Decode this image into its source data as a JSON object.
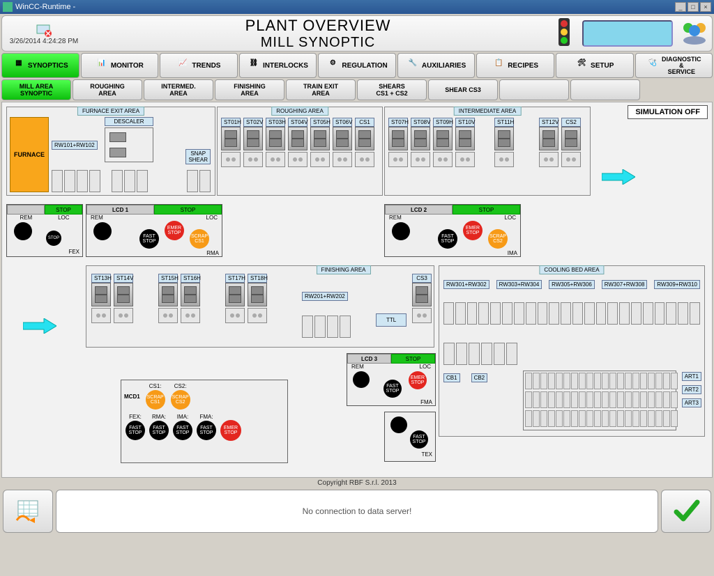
{
  "window": {
    "title": "WinCC-Runtime -"
  },
  "header": {
    "timestamp": "3/26/2014 4:24:28 PM",
    "title1": "PLANT OVERVIEW",
    "title2": "MILL SYNOPTIC"
  },
  "nav": [
    "SYNOPTICS",
    "MONITOR",
    "TRENDS",
    "INTERLOCKS",
    "REGULATION",
    "AUXILIARIES",
    "RECIPES",
    "SETUP",
    "DIAGNOSTIC\n&\nSERVICE"
  ],
  "nav_active": 0,
  "subnav": [
    "MILL AREA\nSYNOPTIC",
    "ROUGHING\nAREA",
    "INTERMED.\nAREA",
    "FINISHING\nAREA",
    "TRAIN EXIT\nAREA",
    "SHEARS\nCS1 + CS2",
    "SHEAR CS3",
    "",
    ""
  ],
  "subnav_active": 0,
  "simulation": "SIMULATION OFF",
  "areas": {
    "furnace_exit": "FURNACE EXIT AREA",
    "roughing": "ROUGHING AREA",
    "intermediate": "INTERMEDIATE AREA",
    "finishing": "FINISHING AREA",
    "cooling": "COOLING BED AREA",
    "furnace": "FURNACE",
    "descaler": "DESCALER",
    "snap_shear": "SNAP\nSHEAR",
    "rw101": "RW101+RW102",
    "rw201": "RW201+RW202",
    "ttl": "TTL"
  },
  "stands": {
    "row1a": [
      "ST01H",
      "ST02V",
      "ST03H",
      "ST04V",
      "ST05H",
      "ST06V",
      "CS1"
    ],
    "row1b": [
      "ST07H",
      "ST08V",
      "ST09H",
      "ST10V"
    ],
    "row1c": [
      "ST11H"
    ],
    "row1d": [
      "ST12V",
      "CS2"
    ],
    "row2a": [
      "ST13H",
      "ST14V"
    ],
    "row2b": [
      "ST15H",
      "ST16H"
    ],
    "row2c": [
      "ST17H",
      "ST18H"
    ],
    "cs3": "CS3",
    "cooling_rw": [
      "RW301+RW302",
      "RW303+RW304",
      "RW305+RW306",
      "RW307+RW308",
      "RW309+RW310"
    ],
    "cb": [
      "CB1",
      "CB2"
    ],
    "art": [
      "ART1",
      "ART2",
      "ART3"
    ]
  },
  "lcd": {
    "fex": {
      "stop": "STOP",
      "rem": "REM",
      "loc": "LOC",
      "tag": "FEX"
    },
    "lcd1": {
      "title": "LCD 1",
      "stop": "STOP",
      "rem": "REM",
      "loc": "LOC",
      "emer": "EMER\nSTOP",
      "fast": "FAST\nSTOP",
      "scrap": "SCRAP\nCS1",
      "tag": "RMA"
    },
    "lcd2": {
      "title": "LCD 2",
      "stop": "STOP",
      "rem": "REM",
      "loc": "LOC",
      "emer": "EMER\nSTOP",
      "fast": "FAST\nSTOP",
      "scrap": "SCRAP\nCS2",
      "tag": "IMA"
    },
    "lcd3": {
      "title": "LCD 3",
      "stop": "STOP",
      "rem": "REM",
      "loc": "LOC",
      "emer": "EMER\nSTOP",
      "fast": "FAST\nSTOP",
      "tag": "FMA"
    },
    "tex": {
      "fast": "FAST\nSTOP",
      "tag": "TEX"
    }
  },
  "mcd": {
    "title": "MCD1",
    "cs1": "CS1:",
    "cs2": "CS2:",
    "scrap1": "SCRAP\nCS1",
    "scrap2": "SCRAP\nCS2",
    "cols": [
      "FEX:",
      "RMA:",
      "IMA:",
      "FMA:"
    ],
    "fast": "FAST\nSTOP",
    "emer": "EMER\nSTOP"
  },
  "footer": {
    "copyright": "Copyright RBF S.r.l. 2013"
  },
  "status": {
    "message": "No connection to data server!"
  }
}
